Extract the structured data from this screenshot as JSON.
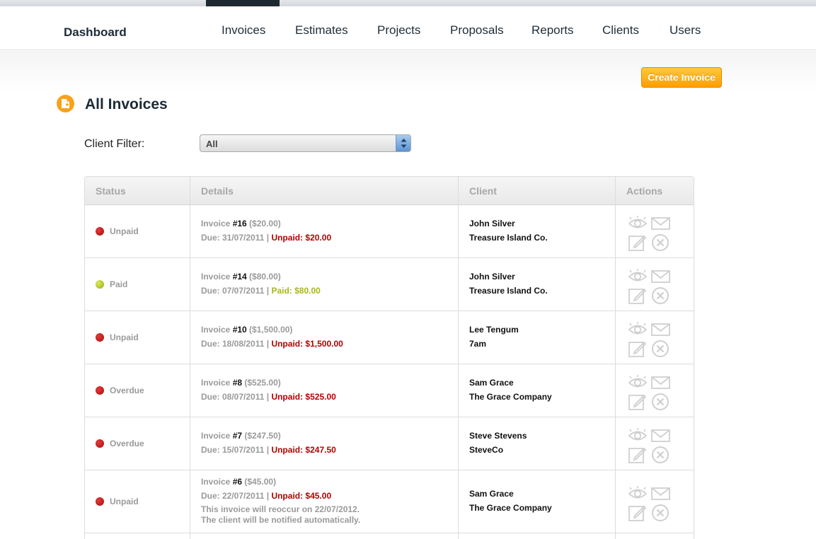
{
  "nav": {
    "brand": "Dashboard",
    "items": [
      "Invoices",
      "Estimates",
      "Projects",
      "Proposals",
      "Reports",
      "Clients",
      "Users"
    ]
  },
  "create_button": "Create Invoice",
  "page_title": "All Invoices",
  "filter": {
    "label": "Client Filter:",
    "value": "All"
  },
  "table": {
    "headers": [
      "Status",
      "Details",
      "Client",
      "Actions"
    ],
    "rows": [
      {
        "status": "Unpaid",
        "prefix": "Invoice ",
        "number": "#16",
        "total": " ($20.00)",
        "due": "Due: 31/07/2011",
        "sep": " | ",
        "balance": "Unpaid: $20.00",
        "client_name": "John Silver",
        "client_company": "Treasure Island Co."
      },
      {
        "status": "Paid",
        "prefix": "Invoice ",
        "number": "#14",
        "total": " ($80.00)",
        "due": "Due: 07/07/2011",
        "sep": " | ",
        "balance": "Paid: $80.00",
        "client_name": "John Silver",
        "client_company": "Treasure Island Co."
      },
      {
        "status": "Unpaid",
        "prefix": "Invoice ",
        "number": "#10",
        "total": " ($1,500.00)",
        "due": "Due: 18/08/2011",
        "sep": " | ",
        "balance": "Unpaid: $1,500.00",
        "client_name": "Lee Tengum",
        "client_company": "7am"
      },
      {
        "status": "Overdue",
        "prefix": "Invoice ",
        "number": "#8",
        "total": " ($525.00)",
        "due": "Due: 08/07/2011",
        "sep": " | ",
        "balance": "Unpaid: $525.00",
        "client_name": "Sam Grace",
        "client_company": "The Grace Company"
      },
      {
        "status": "Overdue",
        "prefix": "Invoice ",
        "number": "#7",
        "total": " ($247.50)",
        "due": "Due: 15/07/2011",
        "sep": " | ",
        "balance": "Unpaid: $247.50",
        "client_name": "Steve Stevens",
        "client_company": "SteveCo"
      },
      {
        "status": "Unpaid",
        "prefix": "Invoice ",
        "number": "#6",
        "total": " ($45.00)",
        "due": "Due: 22/07/2011",
        "sep": " | ",
        "balance": "Unpaid: $45.00",
        "note1": "This invoice will reoccur on 22/07/2012.",
        "note2": "The client will be notified automatically.",
        "client_name": "Sam Grace",
        "client_company": "The Grace Company"
      }
    ]
  },
  "colors": {
    "accent": "#ff9e00",
    "unpaid": "#b40000",
    "paid": "#a9b716",
    "nav_active": "#1e2a33"
  }
}
